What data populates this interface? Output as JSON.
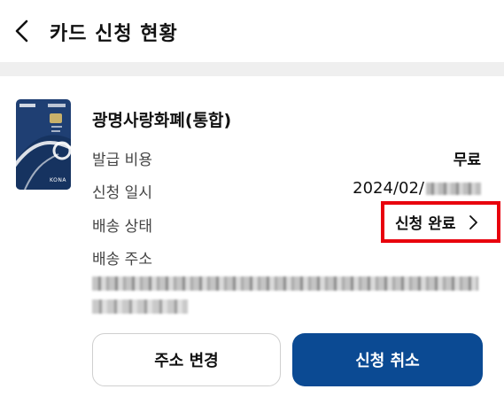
{
  "header": {
    "title": "카드 신청 현황",
    "back_icon": "chevron-left-icon"
  },
  "card": {
    "name": "광명사랑화폐(통합)",
    "image_icon": "card-image",
    "brand_text": "KONA",
    "colors": {
      "card_bg": "#1f3f73",
      "accent": "#0b4a93"
    }
  },
  "details": {
    "fee_label": "발급 비용",
    "fee_value": "무료",
    "date_label": "신청 일시",
    "date_value_visible": "2024/02/",
    "shipping_label": "배송 상태",
    "shipping_status": "신청 완료",
    "address_label": "배송 주소"
  },
  "actions": {
    "change_address": "주소 변경",
    "cancel_application": "신청 취소"
  },
  "colors": {
    "highlight_border": "#e8000d",
    "primary_button": "#0b4a93"
  }
}
